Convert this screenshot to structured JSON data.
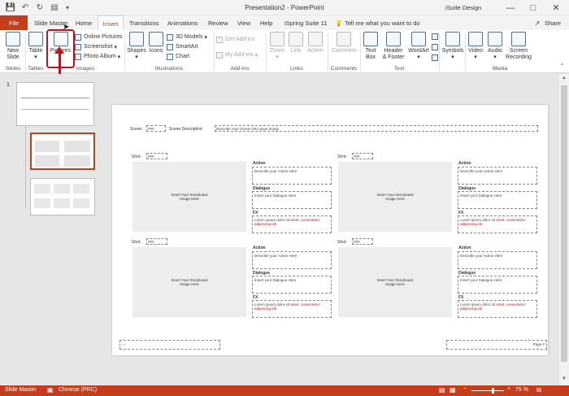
{
  "app": {
    "title": "Presentation2  -  PowerPoint",
    "account": "iSuite Design",
    "brand_color": "#c43e1c"
  },
  "qat": {
    "autosave_icon": "save-icon",
    "undo_icon": "undo-icon",
    "redo_icon": "redo-icon",
    "present_icon": "present-icon",
    "customize_icon": "chevron-down-icon"
  },
  "tabs": [
    "File",
    "Slide Master",
    "Home",
    "Insert",
    "Transitions",
    "Animations",
    "Review",
    "View",
    "Help",
    "iSpring Suite 11"
  ],
  "tell_me": "Tell me what you want to do",
  "share": "Share",
  "ribbon": {
    "slides": {
      "new_slide": "New",
      "new_slide2": "Slide",
      "group": "Slides"
    },
    "tables": {
      "table": "Table",
      "group": "Tables"
    },
    "images": {
      "pictures": "Pictures",
      "online": "Online Pictures",
      "screenshot": "Screenshot",
      "album": "Photo Album",
      "group": "Images"
    },
    "illustrations": {
      "shapes": "Shapes",
      "icons": "Icons",
      "models": "3D Models",
      "smartart": "SmartArt",
      "chart": "Chart",
      "group": "Illustrations"
    },
    "addins": {
      "get": "Get Add-ins",
      "my": "My Add-ins",
      "group": "Add-ins"
    },
    "links": {
      "zoom": "Zoom",
      "link": "Link",
      "action": "Action",
      "group": "Links"
    },
    "comments": {
      "comment": "Comment",
      "group": "Comments"
    },
    "text": {
      "textbox": "Text",
      "textbox2": "Box",
      "header": "Header",
      "header2": "& Footer",
      "wordart": "WordArt",
      "group": "Text"
    },
    "symbols": {
      "symbols": "Symbols"
    },
    "media": {
      "video": "Video",
      "audio": "Audio",
      "screen": "Screen",
      "screen2": "Recording",
      "group": "Media"
    }
  },
  "thumbs": {
    "index": "1"
  },
  "slide": {
    "scene_label": "Scene:",
    "scene_value": "###",
    "desc_label": "Scene Description:",
    "desc_placeholder": "Describe Your Scene OR Leave empty",
    "shot_label": "Shot:",
    "shot_value": "###",
    "action_label": "Action",
    "action_placeholder": "Describe your Action Here",
    "dialogue_label": "Dialogue",
    "dialogue_placeholder": "Insert your Dialogue Here",
    "fx_label": "FX",
    "fx_text": "Lorem ipsum dolor sit",
    "fx_text_err": "amet, consectetur adipiscing elit.",
    "image_placeholder_1": "Insert Your Storyboard",
    "image_placeholder_2": "Image Here",
    "footer_left": "---",
    "footer_right": "Page #"
  },
  "status": {
    "view": "Slide Master",
    "language": "Chinese (PRC)",
    "zoom": "75 %"
  }
}
